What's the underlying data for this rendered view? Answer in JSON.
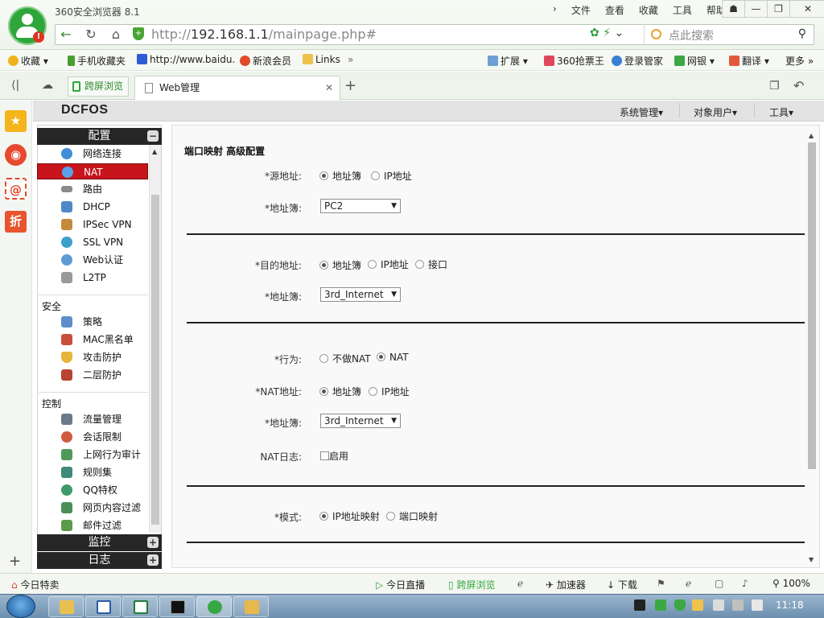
{
  "browser": {
    "app_title": "360安全浏览器 8.1",
    "top_menu": [
      "文件",
      "查看",
      "收藏",
      "工具",
      "帮助"
    ],
    "address": {
      "protocol_host": "http://",
      "host": "192.168.1.1",
      "path": "/mainpage.php#"
    },
    "search_placeholder": "点此搜索",
    "favorites": [
      {
        "label": "收藏",
        "icon": "star-icon"
      },
      {
        "label": "手机收藏夹",
        "icon": "phone-icon"
      },
      {
        "label": "http://www.baidu.",
        "icon": "baidu-icon"
      },
      {
        "label": "新浪会员",
        "icon": "weibo-icon"
      },
      {
        "label": "Links",
        "icon": "folder-icon"
      },
      {
        "label": "扩展",
        "icon": "grid-icon"
      },
      {
        "label": "360抢票王",
        "icon": "ticket-icon"
      },
      {
        "label": "登录管家",
        "icon": "key-icon"
      },
      {
        "label": "网银",
        "icon": "bank-icon"
      },
      {
        "label": "翻译",
        "icon": "translate-icon"
      },
      {
        "label": "更多",
        "icon": "more-icon"
      }
    ],
    "tabs": {
      "split_view": "跨屏浏览",
      "active_tab": "Web管理"
    },
    "status": {
      "left": "今日特卖",
      "live": "今日直播",
      "split": "跨屏浏览",
      "accelerator": "加速器",
      "download": "下载",
      "zoom": "100%"
    }
  },
  "app": {
    "brand": "DCFOS",
    "header_menu": [
      "系统管理",
      "对象用户",
      "工具"
    ],
    "nav": {
      "config_header": "配置",
      "config_items": [
        "网络连接",
        "NAT",
        "路由",
        "DHCP",
        "IPSec VPN",
        "SSL VPN",
        "Web认证",
        "L2TP"
      ],
      "active_item": "NAT",
      "security_label": "安全",
      "security_items": [
        "策略",
        "MAC黑名单",
        "攻击防护",
        "二层防护"
      ],
      "control_label": "控制",
      "control_items": [
        "流量管理",
        "会话限制",
        "上网行为审计",
        "规则集",
        "QQ特权",
        "网页内容过滤",
        "邮件过滤"
      ],
      "monitor_header": "监控",
      "log_header": "日志"
    },
    "form": {
      "title": "端口映射 高级配置",
      "src_addr_label": "*源地址:",
      "src_opts": [
        "地址簿",
        "IP地址"
      ],
      "src_selected": 0,
      "addrbook1_label": "*地址簿:",
      "addrbook1_value": "PC2",
      "dst_addr_label": "*目的地址:",
      "dst_opts": [
        "地址簿",
        "IP地址",
        "接口"
      ],
      "dst_selected": 0,
      "addrbook2_label": "*地址簿:",
      "addrbook2_value": "3rd_Internet",
      "action_label": "*行为:",
      "action_opts": [
        "不做NAT",
        "NAT"
      ],
      "action_selected": 1,
      "nat_addr_label": "*NAT地址:",
      "nat_opts": [
        "地址簿",
        "IP地址"
      ],
      "nat_selected": 0,
      "addrbook3_label": "*地址簿:",
      "addrbook3_value": "3rd_Internet",
      "nat_log_label": "NAT日志:",
      "nat_log_checkbox": "启用",
      "mode_label": "*模式:",
      "mode_opts": [
        "IP地址映射",
        "端口映射"
      ],
      "mode_selected": 0
    }
  },
  "taskbar": {
    "clock": "11:18"
  },
  "colors": {
    "accent_green": "#2fa63b",
    "active_nav": "#c8141b",
    "nav_header": "#262626"
  }
}
